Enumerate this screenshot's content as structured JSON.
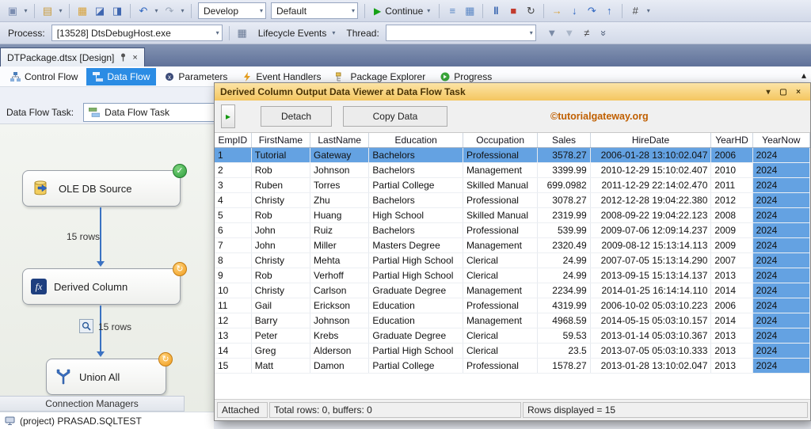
{
  "colors": {
    "selection_blue": "#64a2e2",
    "dialog_title_top": "#fce4a6",
    "dialog_title_bottom": "#f4c660",
    "active_tab_blue": "#2b8ce4",
    "watermark_orange": "#c05f00"
  },
  "icons": {
    "caret_down": "▾",
    "close": "×",
    "check": "✓",
    "running_spinner": "↻",
    "play": "▸",
    "tab_scroll": "▴",
    "fx": "fx"
  },
  "main_toolbar": {
    "items": [
      {
        "name": "window-icon",
        "glyph": "▣",
        "color": "#7b8db0"
      },
      {
        "type": "caret",
        "name": "chevron-down-icon",
        "glyph": "▾"
      },
      {
        "type": "sep"
      },
      {
        "name": "add-item-icon",
        "glyph": "▤",
        "color": "#c99c3f"
      },
      {
        "type": "caret",
        "name": "chevron-down-icon",
        "glyph": "▾"
      },
      {
        "type": "sep"
      },
      {
        "name": "open-folder-icon",
        "glyph": "▦",
        "color": "#d8a33c"
      },
      {
        "name": "save-icon",
        "glyph": "◪",
        "color": "#3f66b0"
      },
      {
        "name": "save-all-icon",
        "glyph": "◨",
        "color": "#3f66b0"
      },
      {
        "type": "sep"
      },
      {
        "name": "undo-icon",
        "glyph": "↶",
        "color": "#2f66c0"
      },
      {
        "type": "caret",
        "name": "chevron-down-icon",
        "glyph": "▾"
      },
      {
        "name": "redo-icon",
        "glyph": "↷",
        "color": "#9aa6b8"
      },
      {
        "type": "caret",
        "name": "chevron-down-icon",
        "glyph": "▾"
      },
      {
        "type": "sep"
      },
      {
        "type": "combo",
        "name": "configuration-dropdown",
        "label": "Develop",
        "width": 86
      },
      {
        "type": "combo",
        "name": "platform-dropdown",
        "label": "Default",
        "width": 110
      },
      {
        "type": "sep"
      },
      {
        "type": "continue",
        "name": "continue-button",
        "label": "Continue"
      },
      {
        "type": "sep"
      },
      {
        "name": "find-in-files-icon",
        "glyph": "≡",
        "color": "#5b87c5"
      },
      {
        "name": "preview-icon",
        "glyph": "▦",
        "color": "#5b87c5"
      },
      {
        "type": "sep"
      },
      {
        "name": "pause-icon",
        "glyph": "‖",
        "color": "#2456a8",
        "bold": true
      },
      {
        "name": "stop-icon",
        "glyph": "■",
        "color": "#c23b2e"
      },
      {
        "name": "restart-icon",
        "glyph": "↻",
        "color": "#444444"
      },
      {
        "type": "sep"
      },
      {
        "name": "show-next-statement-icon",
        "glyph": "→",
        "color": "#d8a33c"
      },
      {
        "name": "step-into-icon",
        "glyph": "↓",
        "color": "#2f66c0"
      },
      {
        "name": "step-over-icon",
        "glyph": "↷",
        "color": "#2f66c0"
      },
      {
        "name": "step-out-icon",
        "glyph": "↑",
        "color": "#2f66c0"
      },
      {
        "type": "sep"
      },
      {
        "name": "hex-display-icon",
        "glyph": "#",
        "color": "#444444"
      },
      {
        "type": "caret",
        "name": "chevron-down-icon",
        "glyph": "▾"
      }
    ]
  },
  "process_bar": {
    "process_label": "Process:",
    "process_value": "[13528] DtsDebugHost.exe",
    "lifecycle_icon_glyph": "▦",
    "lifecycle_label": "Lifecycle Events",
    "thread_label": "Thread:",
    "thread_value": "",
    "right_icons": [
      {
        "name": "filter-icon",
        "glyph": "▼",
        "color": "#7a8aa5"
      },
      {
        "name": "filter-settings-icon",
        "glyph": "▼",
        "color": "#aab6c8"
      },
      {
        "name": "flagged-threads-icon",
        "glyph": "≠",
        "color": "#444444"
      },
      {
        "name": "toolbar-overflow-icon",
        "glyph": "»",
        "color": "#4a5a74",
        "rot": true
      }
    ]
  },
  "document_tab": {
    "title": "DTPackage.dtsx [Design]"
  },
  "designer_tabs": [
    {
      "id": "control-flow",
      "label": "Control Flow",
      "active": false
    },
    {
      "id": "data-flow",
      "label": "Data Flow",
      "active": true
    },
    {
      "id": "parameters",
      "label": "Parameters",
      "active": false
    },
    {
      "id": "event-handlers",
      "label": "Event Handlers",
      "active": false
    },
    {
      "id": "package-explorer",
      "label": "Package Explorer",
      "active": false
    },
    {
      "id": "progress",
      "label": "Progress",
      "active": false
    }
  ],
  "data_flow_task": {
    "label": "Data Flow Task:",
    "value": "Data Flow Task"
  },
  "design_surface": {
    "nodes": [
      {
        "title": "OLE DB Source",
        "badge": "success"
      },
      {
        "title": "Derived Column",
        "badge": "running"
      },
      {
        "title": "Union All",
        "badge": "running"
      }
    ],
    "edge_label_1": "15 rows",
    "edge_label_2": "15 rows"
  },
  "connection_managers": {
    "header": "Connection Managers",
    "item": "(project) PRASAD.SQLTEST"
  },
  "dialog": {
    "title": "Derived Column Output Data Viewer at Data Flow Task",
    "window_buttons": [
      {
        "name": "collapse-icon",
        "glyph": "▾"
      },
      {
        "name": "maximize-icon",
        "glyph": "▢"
      },
      {
        "name": "close-icon",
        "glyph": "×"
      }
    ],
    "detach_label": "Detach",
    "copy_label": "Copy Data",
    "watermark": "©tutorialgateway.org",
    "grid": {
      "selected_row": 0,
      "columns": [
        {
          "label": "EmpID",
          "width": 46,
          "align": "left"
        },
        {
          "label": "FirstName",
          "width": 74,
          "align": "left"
        },
        {
          "label": "LastName",
          "width": 74,
          "align": "left"
        },
        {
          "label": "Education",
          "width": 118,
          "align": "left"
        },
        {
          "label": "Occupation",
          "width": 94,
          "align": "left"
        },
        {
          "label": "Sales",
          "width": 66,
          "align": "right"
        },
        {
          "label": "HireDate",
          "width": 152,
          "align": "right"
        },
        {
          "label": "YearHD",
          "width": 52,
          "align": "left"
        },
        {
          "label": "YearNow",
          "width": 72,
          "align": "left",
          "highlight": true
        }
      ],
      "rows": [
        [
          "1",
          "Tutorial",
          "Gateway",
          "Bachelors",
          "Professional",
          "3578.27",
          "2006-01-28 13:10:02.047",
          "2006",
          "2024"
        ],
        [
          "2",
          "Rob",
          "Johnson",
          "Bachelors",
          "Management",
          "3399.99",
          "2010-12-29 15:10:02.407",
          "2010",
          "2024"
        ],
        [
          "3",
          "Ruben",
          "Torres",
          "Partial College",
          "Skilled Manual",
          "699.0982",
          "2011-12-29 22:14:02.470",
          "2011",
          "2024"
        ],
        [
          "4",
          "Christy",
          "Zhu",
          "Bachelors",
          "Professional",
          "3078.27",
          "2012-12-28 19:04:22.380",
          "2012",
          "2024"
        ],
        [
          "5",
          "Rob",
          "Huang",
          "High School",
          "Skilled Manual",
          "2319.99",
          "2008-09-22 19:04:22.123",
          "2008",
          "2024"
        ],
        [
          "6",
          "John",
          "Ruiz",
          "Bachelors",
          "Professional",
          "539.99",
          "2009-07-06 12:09:14.237",
          "2009",
          "2024"
        ],
        [
          "7",
          "John",
          "Miller",
          "Masters Degree",
          "Management",
          "2320.49",
          "2009-08-12 15:13:14.113",
          "2009",
          "2024"
        ],
        [
          "8",
          "Christy",
          "Mehta",
          "Partial High School",
          "Clerical",
          "24.99",
          "2007-07-05 15:13:14.290",
          "2007",
          "2024"
        ],
        [
          "9",
          "Rob",
          "Verhoff",
          "Partial High School",
          "Clerical",
          "24.99",
          "2013-09-15 15:13:14.137",
          "2013",
          "2024"
        ],
        [
          "10",
          "Christy",
          "Carlson",
          "Graduate Degree",
          "Management",
          "2234.99",
          "2014-01-25 16:14:14.110",
          "2014",
          "2024"
        ],
        [
          "11",
          "Gail",
          "Erickson",
          "Education",
          "Professional",
          "4319.99",
          "2006-10-02 05:03:10.223",
          "2006",
          "2024"
        ],
        [
          "12",
          "Barry",
          "Johnson",
          "Education",
          "Management",
          "4968.59",
          "2014-05-15 05:03:10.157",
          "2014",
          "2024"
        ],
        [
          "13",
          "Peter",
          "Krebs",
          "Graduate Degree",
          "Clerical",
          "59.53",
          "2013-01-14 05:03:10.367",
          "2013",
          "2024"
        ],
        [
          "14",
          "Greg",
          "Alderson",
          "Partial High School",
          "Clerical",
          "23.5",
          "2013-07-05 05:03:10.333",
          "2013",
          "2024"
        ],
        [
          "15",
          "Matt",
          "Damon",
          "Partial College",
          "Professional",
          "1578.27",
          "2013-01-28 13:10:02.047",
          "2013",
          "2024"
        ]
      ]
    },
    "status": {
      "attached": "Attached",
      "totals": "Total rows: 0, buffers: 0",
      "rows_displayed": "Rows displayed = 15"
    }
  }
}
